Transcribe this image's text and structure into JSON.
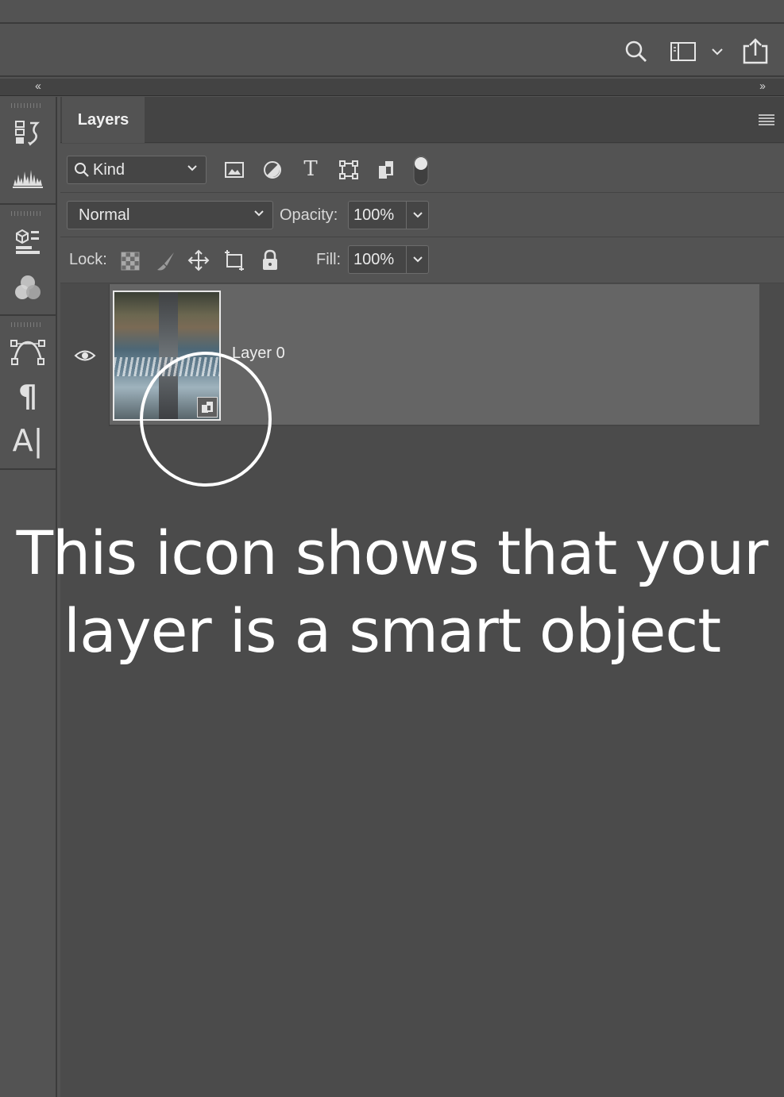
{
  "appbar": {
    "icons": [
      "search-icon",
      "workspace-icon",
      "chevron-down-icon",
      "share-icon"
    ]
  },
  "collapse": {
    "left": "‹‹",
    "right": "››"
  },
  "tools": [
    "history-icon",
    "histogram-icon",
    "properties-icon",
    "color-channels-icon",
    "paths-icon",
    "paragraph-icon",
    "character-icon"
  ],
  "tool_glyphs": {
    "paragraph": "¶",
    "character": "A|"
  },
  "panel": {
    "tab_label": "Layers",
    "filter": {
      "kind_label": "Kind",
      "icons": [
        "pixel-filter-icon",
        "adjustment-filter-icon",
        "type-filter-icon",
        "shape-filter-icon",
        "smart-object-filter-icon",
        "filter-toggle-icon"
      ],
      "type_glyph": "T"
    },
    "blend_mode": "Normal",
    "opacity_label": "Opacity:",
    "opacity_value": "100%",
    "lock_label": "Lock:",
    "lock_icons": [
      "lock-transparent-icon",
      "lock-paint-icon",
      "lock-position-icon",
      "lock-artboard-icon",
      "lock-all-icon"
    ],
    "fill_label": "Fill:",
    "fill_value": "100%"
  },
  "layers": [
    {
      "name": "Layer 0",
      "visible": true,
      "smart_object": true
    }
  ],
  "caption": {
    "line1": "This icon shows that your",
    "line2": "layer is a smart object"
  },
  "colors": {
    "background": "#535353",
    "panel": "#4b4b4b",
    "selected_layer": "#656565",
    "annotation": "#ffffff"
  }
}
